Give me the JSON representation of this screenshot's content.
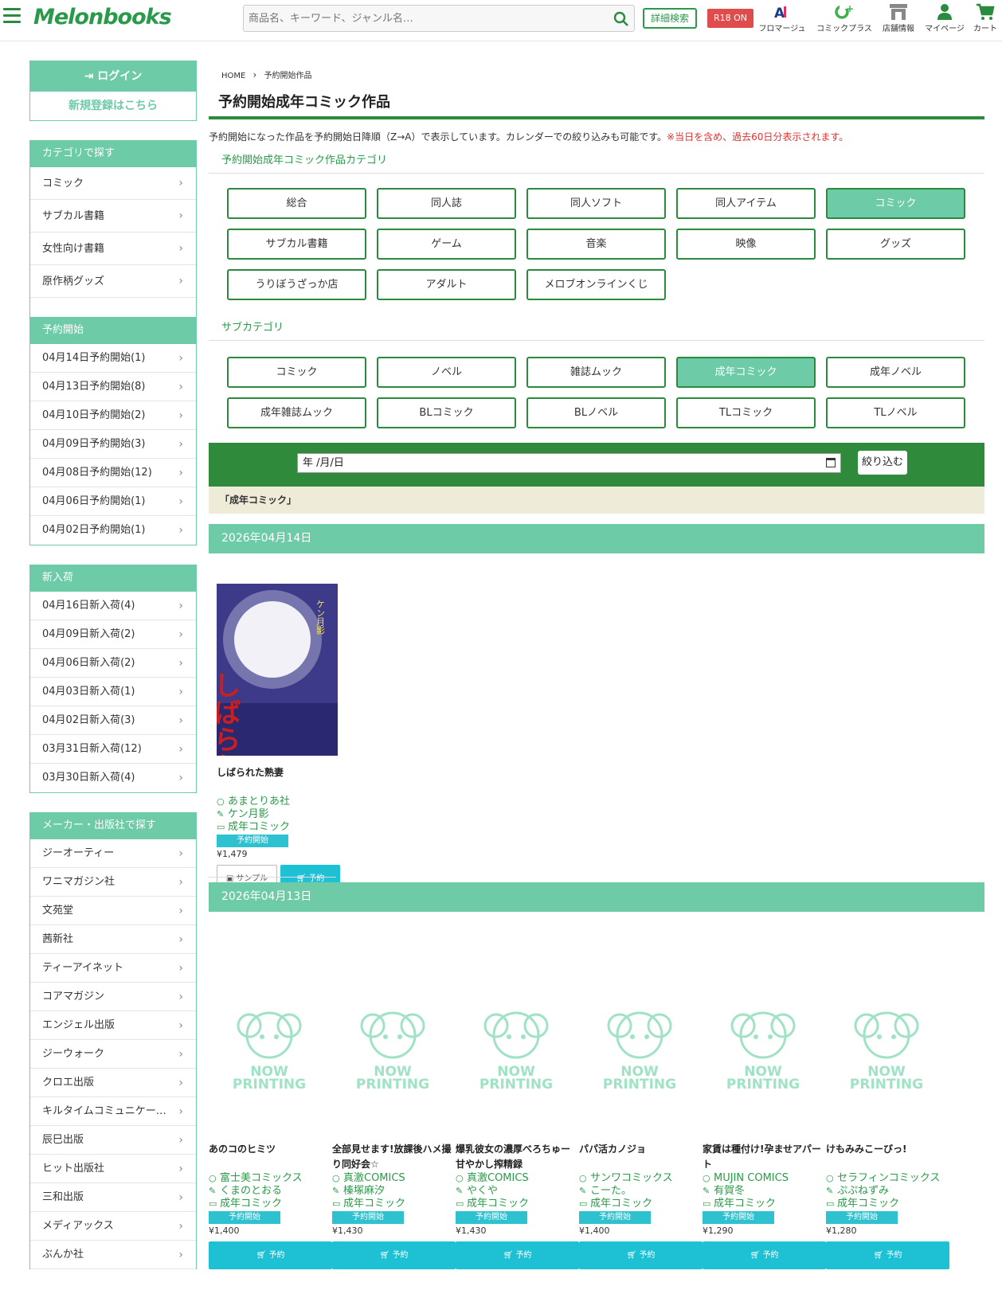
{
  "header": {
    "logo": "Melonbooks",
    "search_placeholder": "商品名、キーワード、ジャンル名…",
    "advanced_search": "詳細検索",
    "r18": "R18 ON",
    "nav": [
      {
        "label": "フロマージュ",
        "icon": "fromage-icon"
      },
      {
        "label": "コミックプラス",
        "icon": "comic-plus-icon"
      },
      {
        "label": "店舗情報",
        "icon": "store-icon"
      },
      {
        "label": "マイページ",
        "icon": "user-icon"
      },
      {
        "label": "カート",
        "icon": "cart-icon"
      }
    ]
  },
  "sidebar": {
    "login": "ログイン",
    "register": "新規登録はこちら",
    "category_head": "カテゴリで探す",
    "categories": [
      "コミック",
      "サブカル書籍",
      "女性向け書籍",
      "原作柄グッズ"
    ],
    "preorder_head": "予約開始",
    "preorder": [
      "04月14日予約開始(1)",
      "04月13日予約開始(8)",
      "04月10日予約開始(2)",
      "04月09日予約開始(3)",
      "04月08日予約開始(12)",
      "04月06日予約開始(1)",
      "04月02日予約開始(1)"
    ],
    "arrival_head": "新入荷",
    "arrival": [
      "04月16日新入荷(4)",
      "04月09日新入荷(2)",
      "04月06日新入荷(2)",
      "04月03日新入荷(1)",
      "04月02日新入荷(3)",
      "03月31日新入荷(12)",
      "03月30日新入荷(4)"
    ],
    "maker_head": "メーカー・出版社で探す",
    "makers": [
      "ジーオーティー",
      "ワニマガジン社",
      "文苑堂",
      "茜新社",
      "ティーアイネット",
      "コアマガジン",
      "エンジェル出版",
      "ジーウォーク",
      "クロエ出版",
      "キルタイムコミュニケー…",
      "辰巳出版",
      "ヒット出版社",
      "三和出版",
      "メディアックス",
      "ぶんか社"
    ]
  },
  "main": {
    "breadcrumb_home": "HOME",
    "breadcrumb_current": "予約開始作品",
    "title": "予約開始成年コミック作品",
    "desc": "予約開始になった作品を予約開始日降順（Z→A）で表示しています。カレンダーでの絞り込みも可能です。",
    "desc_red": "※当日を含め、過去60日分表示されます。",
    "cat_label": "予約開始成年コミック作品カテゴリ",
    "cats": [
      "総合",
      "同人誌",
      "同人ソフト",
      "同人アイテム",
      "コミック",
      "サブカル書籍",
      "ゲーム",
      "音楽",
      "映像",
      "グッズ",
      "うりぼうざっか店",
      "アダルト",
      "メロブオンラインくじ"
    ],
    "cat_active": "コミック",
    "subcat_label": "サブカテゴリ",
    "subcats": [
      "コミック",
      "ノベル",
      "雑誌ムック",
      "成年コミック",
      "成年ノベル",
      "成年雑誌ムック",
      "BLコミック",
      "BLノベル",
      "TLコミック",
      "TLノベル"
    ],
    "subcat_active": "成年コミック",
    "date_value": "年 /月/日",
    "filter_button": "絞り込む",
    "filter_note": "「成年コミック」",
    "date1": "2026年04月14日",
    "date2": "2026年04月13日",
    "badge": "予約開始",
    "sample": "サンプル",
    "buy": "予約",
    "nowprinting": [
      "NOW",
      "PRINTING"
    ],
    "product1": {
      "name": "しばられた熟妻",
      "circle": "あまとりあ社",
      "author": "ケン月影",
      "genre": "成年コミック",
      "price": "¥1,479",
      "cover_title": "しばられた熟妻",
      "cover_author": "ケン月影"
    },
    "products2": [
      {
        "name": "あのコのヒミツ",
        "circle": "富士美コミックス",
        "author": "くまのとおる",
        "genre": "成年コミック",
        "price": "¥1,400"
      },
      {
        "name": "全部見せます!放課後ハメ撮り同好会☆",
        "circle": "真激COMICS",
        "author": "榛塚麻汐",
        "genre": "成年コミック",
        "price": "¥1,430"
      },
      {
        "name": "爆乳彼女の濃厚べろちゅー甘やかし搾精録",
        "circle": "真激COMICS",
        "author": "やくや",
        "genre": "成年コミック",
        "price": "¥1,430"
      },
      {
        "name": "パパ活カノジョ",
        "circle": "サンワコミックス",
        "author": "こーた。",
        "genre": "成年コミック",
        "price": "¥1,400"
      },
      {
        "name": "家賃は種付け!孕ませアパート",
        "circle": "MUJIN COMICS",
        "author": "有賀冬",
        "genre": "成年コミック",
        "price": "¥1,290"
      },
      {
        "name": "けもみみこーびっ!",
        "circle": "セラフィンコミックス",
        "author": "ぷぷねずみ",
        "genre": "成年コミック",
        "price": "¥1,280"
      }
    ]
  }
}
